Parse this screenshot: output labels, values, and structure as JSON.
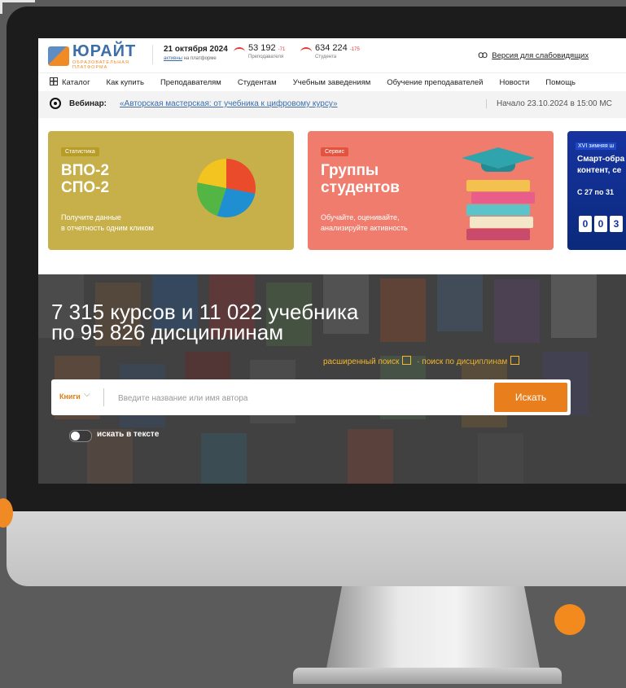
{
  "header": {
    "logo_name": "ЮРАЙТ",
    "logo_sub": "ОБРАЗОВАТЕЛЬНАЯ ПЛАТФОРМА",
    "date": "21 октября 2024",
    "active_link": "активны",
    "active_suffix": "на платформе",
    "teachers_count": "53 192",
    "teachers_delta": "-71",
    "teachers_label": "Преподавателя",
    "students_count": "634 224",
    "students_delta": "-175",
    "students_label": "Студента",
    "low_vision": "Версия для слабовидящих",
    "accent_color": "#f08a24",
    "brand_color": "#3d6ea7"
  },
  "nav": {
    "items": [
      "Каталог",
      "Как купить",
      "Преподавателям",
      "Студентам",
      "Учебным заведениям",
      "Обучение преподавателей",
      "Новости",
      "Помощь"
    ]
  },
  "webinar": {
    "label": "Вебинар:",
    "link": "«Авторская мастерская: от учебника к цифровому курсу»",
    "start": "Начало 23.10.2024 в 15:00 МС"
  },
  "cards": [
    {
      "tag": "Статистика",
      "title_line1": "ВПО-2",
      "title_line2": "СПО-2",
      "desc_line1": "Получите данные",
      "desc_line2": "в отчетность одним кликом"
    },
    {
      "tag": "Сервис",
      "title_line1": "Группы",
      "title_line2": "студентов",
      "desc_line1": "Обучайте, оценивайте,",
      "desc_line2": "анализируйте активность"
    },
    {
      "tag": "XVI зимняя ш",
      "title_line1": "Смарт-обра",
      "title_line2": "контент, се",
      "desc": "С 27 по 31",
      "digits": [
        "0",
        "0",
        "3"
      ]
    }
  ],
  "hero": {
    "title_line1": "7 315 курсов и 11 022 учебника",
    "title_line2": "по 95 826 дисциплинам",
    "advanced_search": "расширенный поиск",
    "discipline_search": "поиск по дисциплинам",
    "search_mode": "Книги",
    "search_placeholder": "Введите название или имя автора",
    "search_button": "Искать",
    "toggle_label": "искать в тексте"
  }
}
